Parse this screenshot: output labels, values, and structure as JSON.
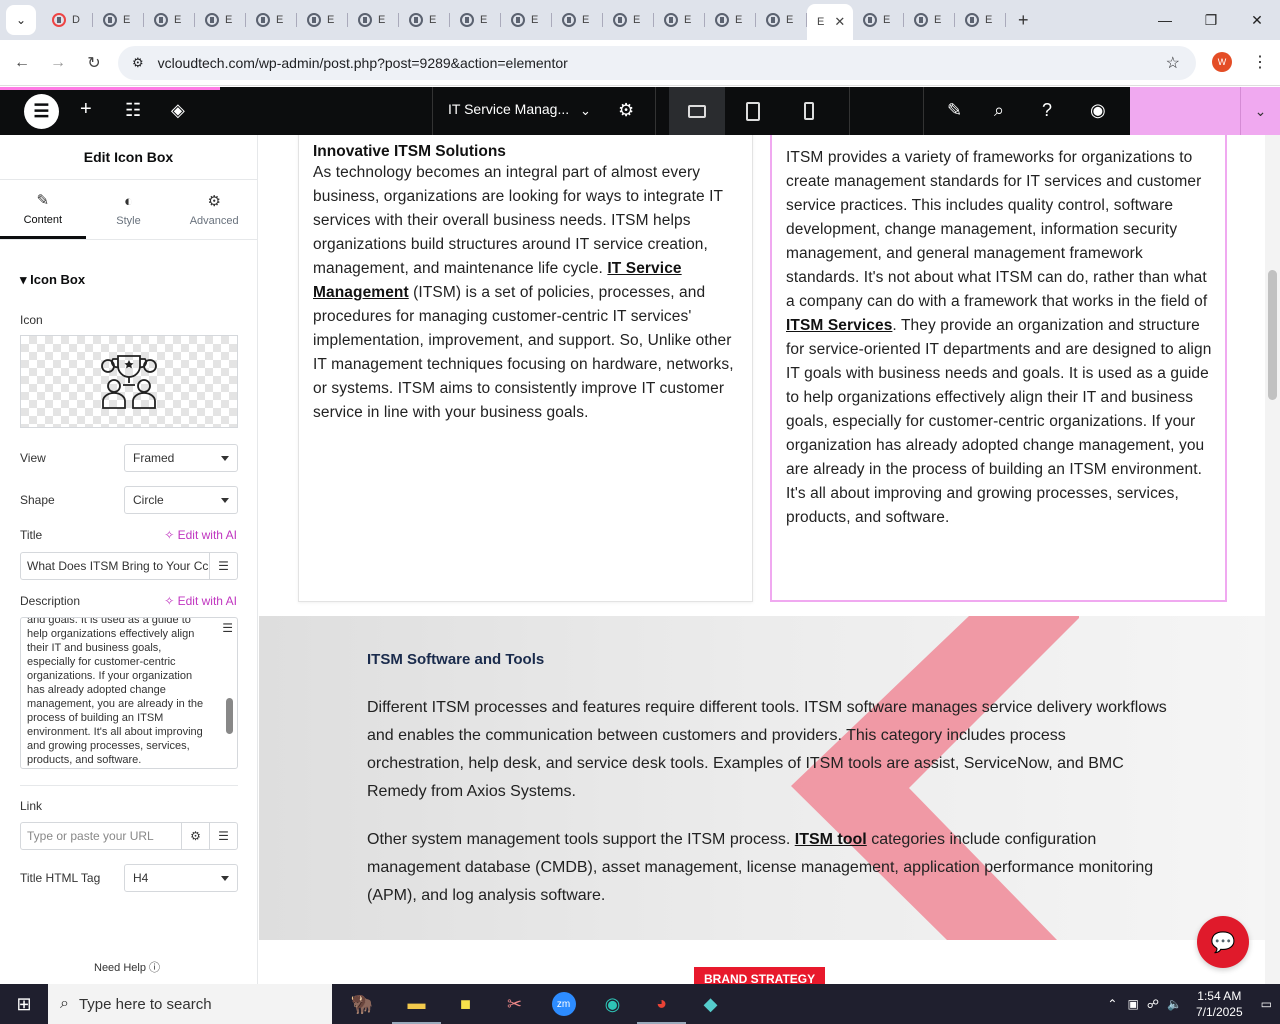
{
  "browser": {
    "url": "vcloudtech.com/wp-admin/post.php?post=9289&action=elementor",
    "tabs": [
      "D",
      "E",
      "E",
      "E",
      "E",
      "E",
      "E",
      "E",
      "E",
      "E",
      "E",
      "E",
      "E",
      "E",
      "E",
      "E",
      "E",
      "E",
      "E"
    ],
    "active_tab_label": "E"
  },
  "elementor": {
    "page_title": "IT Service Manag...",
    "panel_title": "Edit Icon Box",
    "tabs": {
      "content": "Content",
      "style": "Style",
      "advanced": "Advanced"
    },
    "section": "Icon Box",
    "icon_label": "Icon",
    "view_label": "View",
    "view_value": "Framed",
    "shape_label": "Shape",
    "shape_value": "Circle",
    "title_label": "Title",
    "edit_ai": "Edit with AI",
    "title_value": "What Does ITSM Bring to Your Cc",
    "description_label": "Description",
    "description_value": "and goals. It is used as a guide to help organizations effectively align their IT and business goals, especially for customer-centric organizations. If your organization has already adopted change management, you are already in the process of building an ITSM environment. It's all about improving and growing processes, services, products, and software.",
    "link_label": "Link",
    "link_placeholder": "Type or paste your URL",
    "tag_label": "Title HTML Tag",
    "tag_value": "H4",
    "need_help": "Need Help"
  },
  "canvas": {
    "card1": {
      "title": "Innovative ITSM Solutions",
      "text1": "As technology becomes an integral part of almost every business, organizations are looking for ways to integrate IT services with their overall business needs. ITSM helps organizations build structures around IT service creation, management, and maintenance life cycle.",
      "link": "IT Service Management",
      "text2": "(ITSM) is a set of policies, processes, and procedures for managing customer-centric IT services' implementation, improvement, and support. So, Unlike other IT management techniques focusing on hardware, networks, or systems. ITSM aims to consistently improve IT customer service in line with your business goals."
    },
    "card2": {
      "text1": "ITSM provides a variety of frameworks for organizations to create management standards for IT services and customer service practices. This includes quality control, software development, change management, information security management, and general management framework standards. It's not about what ITSM can do, rather than what a company can do with a framework that works in the field of",
      "link": "ITSM Services",
      "text2": ". They provide an organization and structure for service-oriented IT departments and are designed to align IT goals with business needs and goals. It is used as a guide to help organizations effectively align their IT and business goals, especially for customer-centric organizations. If your organization has already adopted change management, you are already in the process of building an ITSM environment. It's all about improving and growing processes, services, products, and software."
    },
    "band": {
      "title": "ITSM Software and Tools",
      "para1": "Different ITSM processes and features require different tools. ITSM software manages service delivery workflows and enables the communication between customers and providers. This category includes process orchestration, help desk, and service desk tools. Examples of ITSM tools are assist, ServiceNow, and BMC Remedy from Axios Systems.",
      "para2a": "Other system management tools support the ITSM process.",
      "para2link": "ITSM tool",
      "para2b": "categories include configuration management database (CMDB), asset management, license management, application performance monitoring (APM), and log analysis software."
    },
    "badge": "BRAND STRATEGY"
  },
  "taskbar": {
    "search_placeholder": "Type here to search",
    "time": "1:54 AM",
    "date": "7/1/2025"
  },
  "colors": {
    "accent": "#f0a9f0",
    "chevron": "#f08a98",
    "brand_red": "#e01a2b"
  }
}
